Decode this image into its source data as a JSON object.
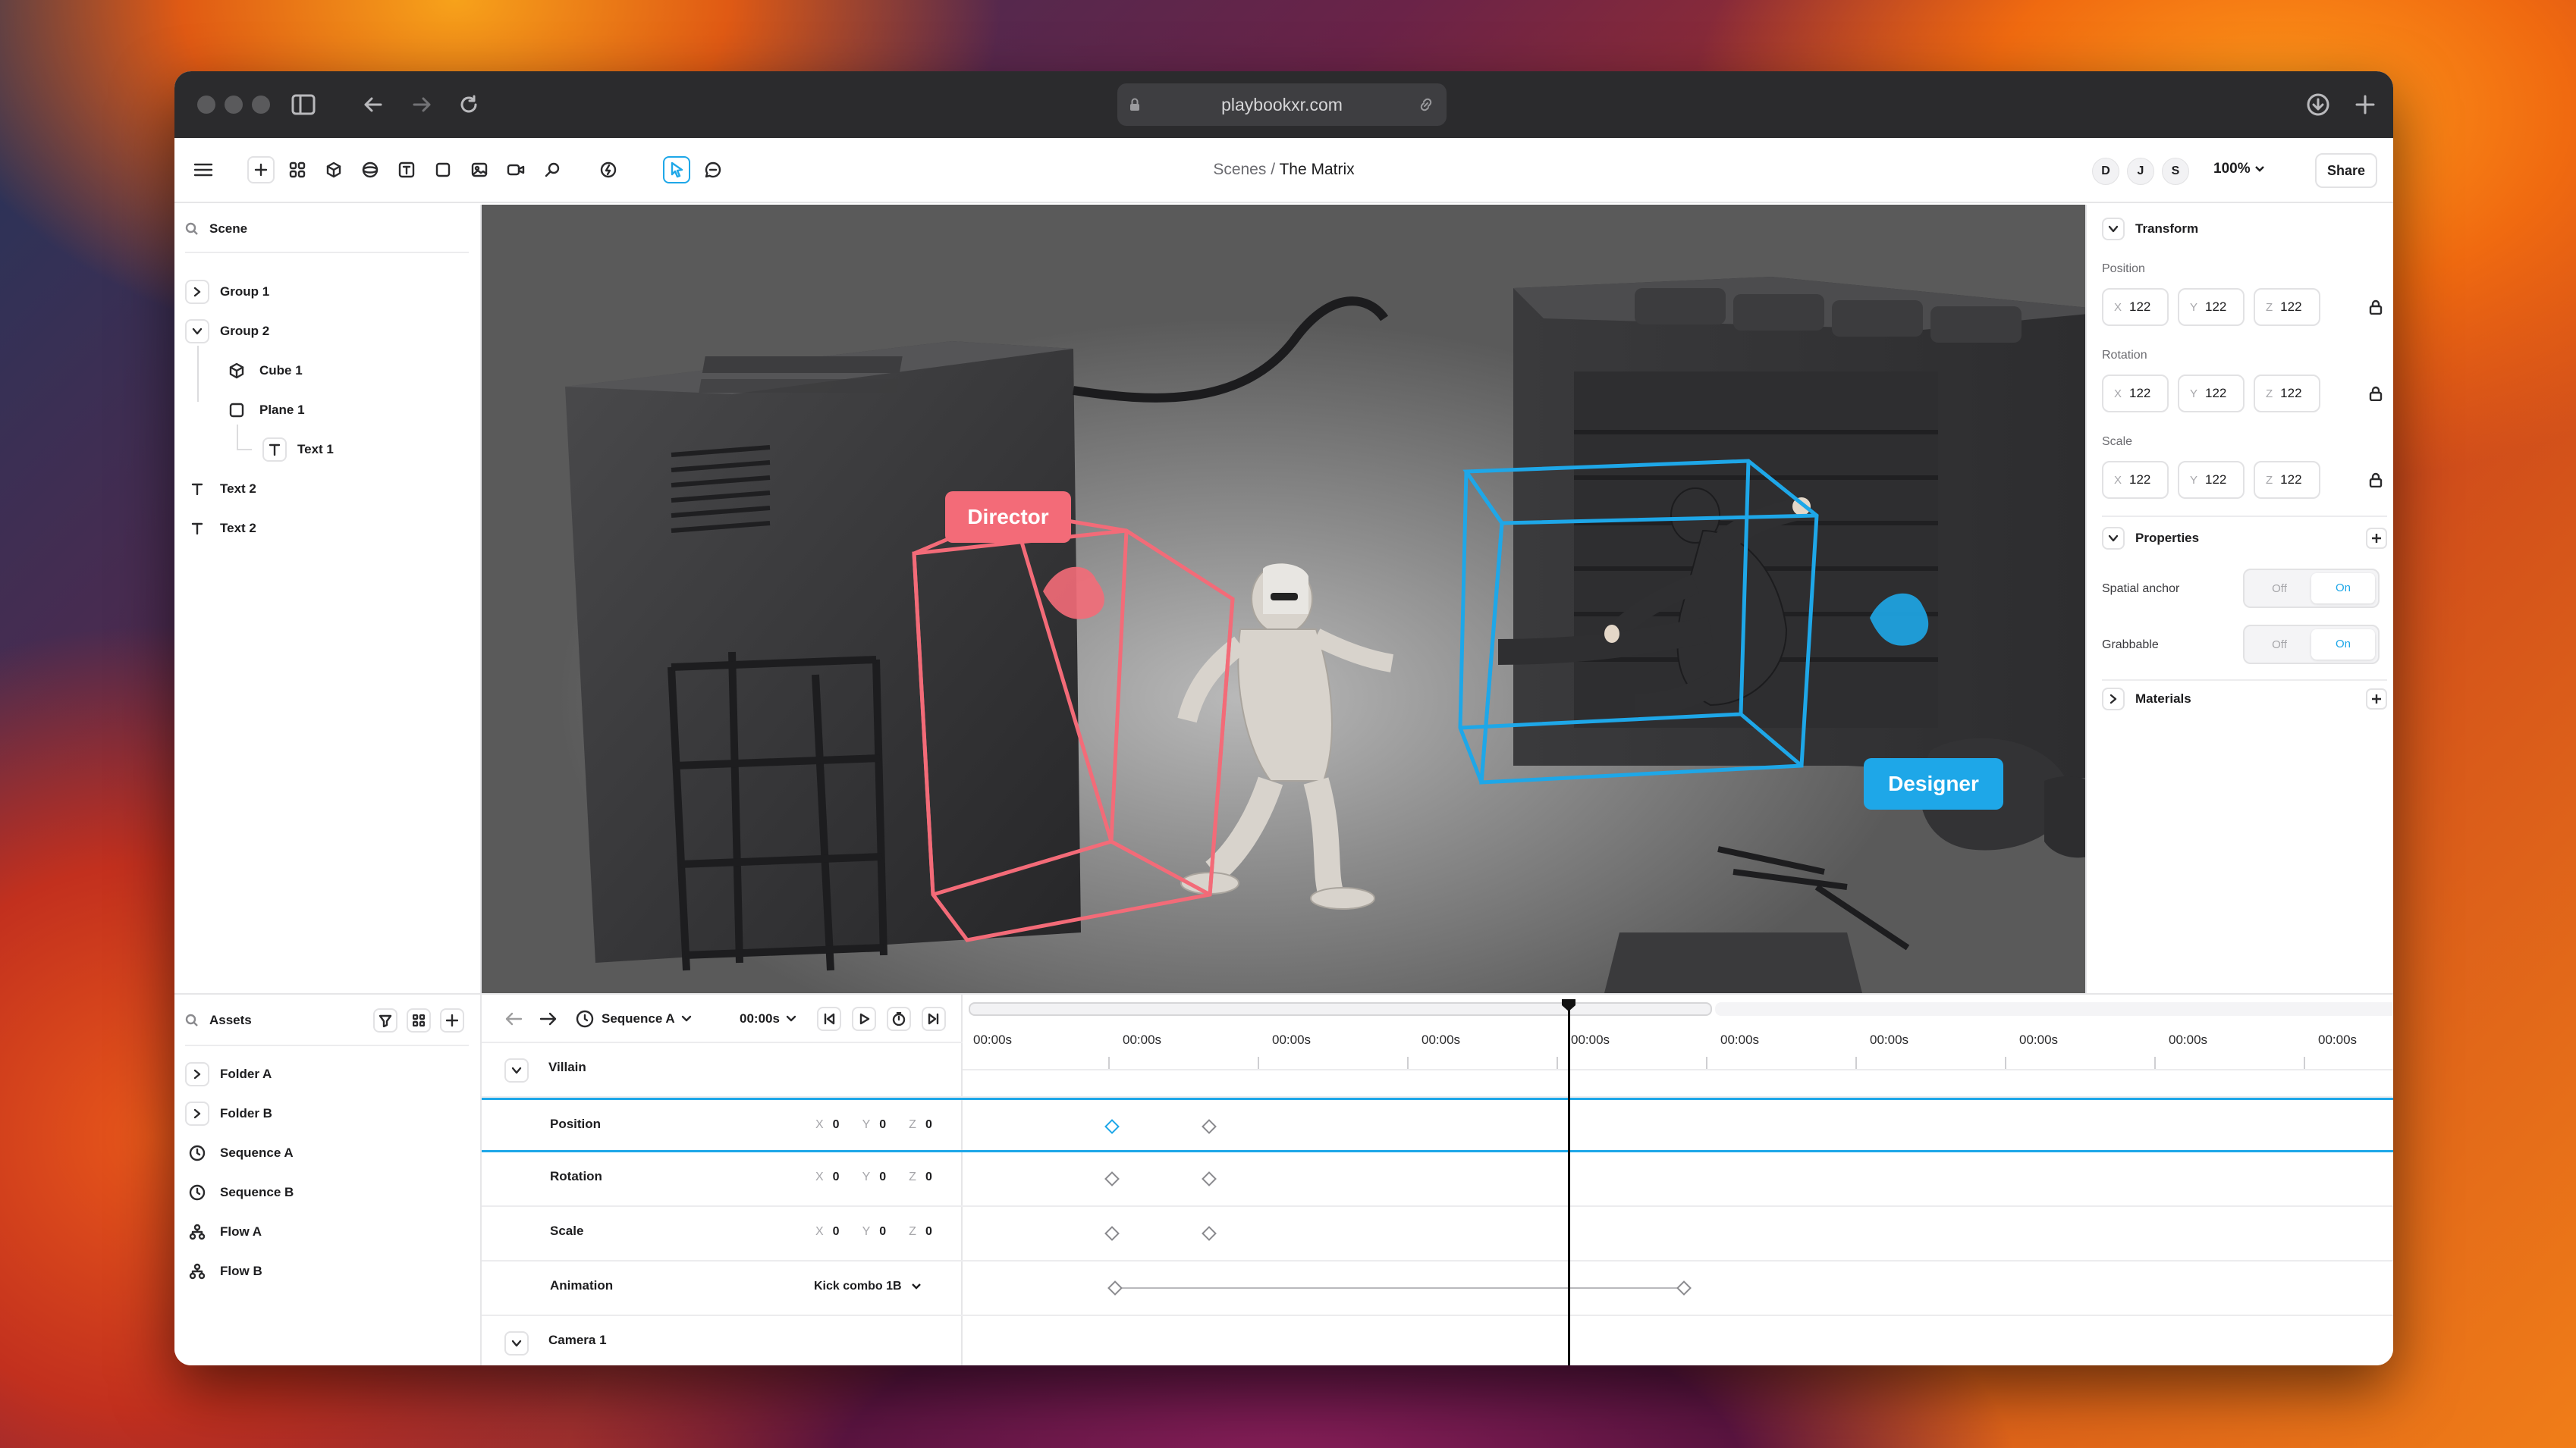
{
  "browser": {
    "url": "playbookxr.com"
  },
  "header": {
    "crumb_parent": "Scenes",
    "crumb_sep": " / ",
    "crumb_current": "The Matrix",
    "zoom": "100%",
    "share_label": "Share",
    "avatars": [
      "D",
      "J",
      "S"
    ]
  },
  "scene_panel": {
    "title": "Scene",
    "items": [
      {
        "label": "Group 1",
        "icon": "chevron-right-icon"
      },
      {
        "label": "Group 2",
        "icon": "chevron-down-icon"
      },
      {
        "label": "Cube 1",
        "icon": "cube-icon"
      },
      {
        "label": "Plane 1",
        "icon": "square-icon"
      },
      {
        "label": "Text 1",
        "icon": "text-icon"
      },
      {
        "label": "Text 2",
        "icon": "text-icon"
      },
      {
        "label": "Text 2",
        "icon": "text-icon"
      }
    ]
  },
  "viewport": {
    "labels": [
      {
        "text": "Director",
        "color": "#f36b78"
      },
      {
        "text": "Designer",
        "color": "#1ea7e8"
      }
    ]
  },
  "inspector": {
    "transform_title": "Transform",
    "position_label": "Position",
    "rotation_label": "Rotation",
    "scale_label": "Scale",
    "position": {
      "x": "122",
      "y": "122",
      "z": "122"
    },
    "rotation": {
      "x": "122",
      "y": "122",
      "z": "122"
    },
    "scale": {
      "x": "122",
      "y": "122",
      "z": "122"
    },
    "properties_title": "Properties",
    "spatial_anchor_label": "Spatial anchor",
    "grabbable_label": "Grabbable",
    "off_label": "Off",
    "on_label": "On",
    "materials_title": "Materials"
  },
  "assets_panel": {
    "title": "Assets",
    "items": [
      {
        "label": "Folder A",
        "icon": "chevron-right-icon"
      },
      {
        "label": "Folder B",
        "icon": "chevron-right-icon"
      },
      {
        "label": "Sequence A",
        "icon": "clock-icon"
      },
      {
        "label": "Sequence B",
        "icon": "clock-icon"
      },
      {
        "label": "Flow A",
        "icon": "flow-icon"
      },
      {
        "label": "Flow B",
        "icon": "flow-icon"
      }
    ]
  },
  "timeline": {
    "sequence": "Sequence A",
    "time": "00:00s",
    "ticks": [
      "00:00s",
      "00:00s",
      "00:00s",
      "00:00s",
      "00:00s",
      "00:00s",
      "00:00s",
      "00:00s",
      "00:00s",
      "00:00s"
    ],
    "villain_label": "Villain",
    "camera_label": "Camera 1",
    "rows": [
      {
        "name": "Position",
        "x": "0",
        "y": "0",
        "z": "0"
      },
      {
        "name": "Rotation",
        "x": "0",
        "y": "0",
        "z": "0"
      },
      {
        "name": "Scale",
        "x": "0",
        "y": "0",
        "z": "0"
      }
    ],
    "animation_label": "Animation",
    "animation_value": "Kick combo 1B"
  },
  "colors": {
    "accent": "#1ea7e8",
    "director": "#f36b78"
  }
}
